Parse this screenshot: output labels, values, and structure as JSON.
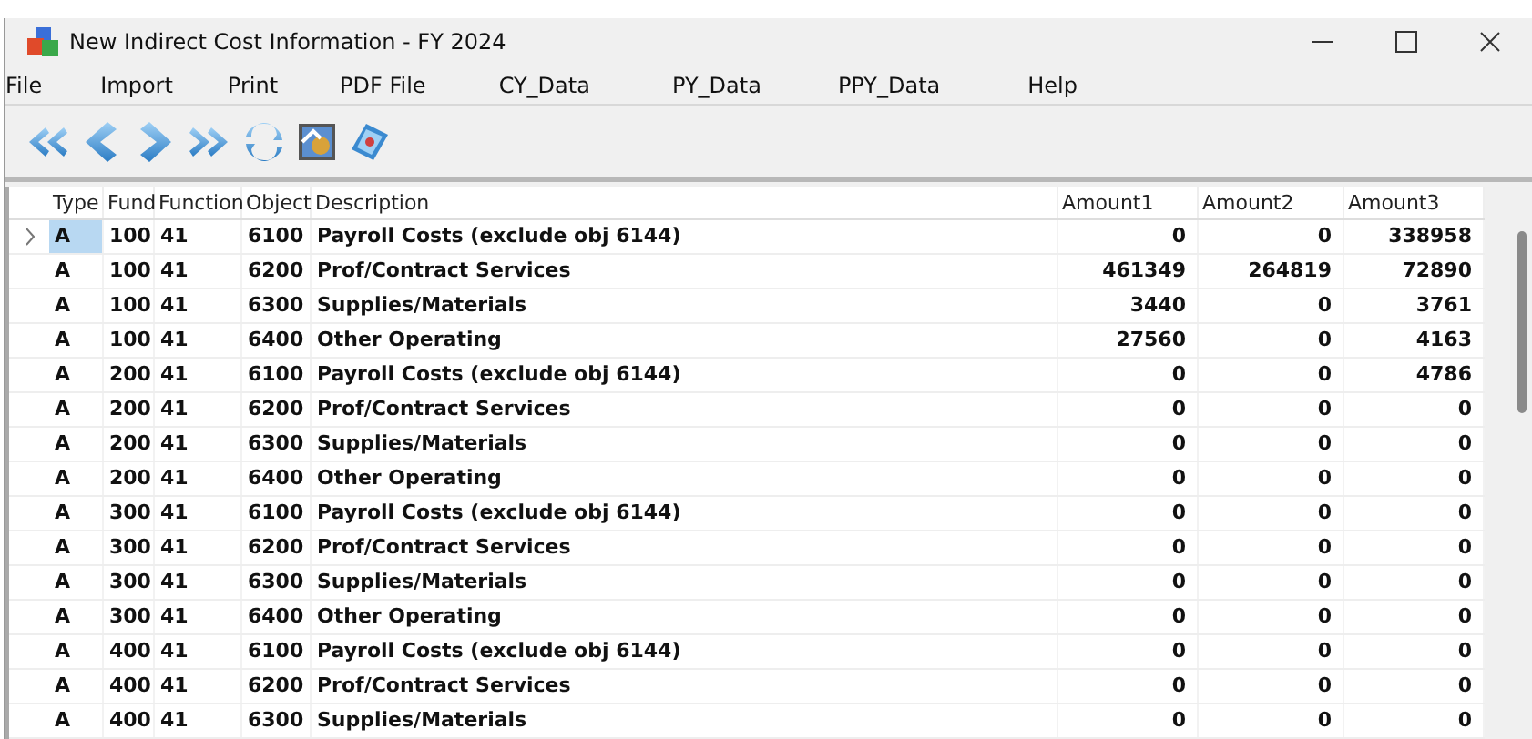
{
  "window": {
    "title": "New Indirect Cost Information - FY 2024"
  },
  "menu": [
    "File",
    "Import",
    "Print",
    "PDF File",
    "CY_Data",
    "PY_Data",
    "PPY_Data",
    "Help"
  ],
  "toolbar": [
    {
      "kind": "first"
    },
    {
      "kind": "prev"
    },
    {
      "kind": "next"
    },
    {
      "kind": "last"
    },
    {
      "kind": "refresh"
    },
    {
      "kind": "image"
    },
    {
      "kind": "help"
    }
  ],
  "table": {
    "columns": [
      "Type",
      "Fund",
      "Function",
      "Object",
      "Description",
      "Amount1",
      "Amount2",
      "Amount3"
    ],
    "rows": [
      {
        "selected": true,
        "cells": [
          "A",
          "100",
          "41",
          "6100",
          "Payroll Costs (exclude obj 6144)",
          "0",
          "0",
          "338958"
        ]
      },
      {
        "selected": false,
        "cells": [
          "A",
          "100",
          "41",
          "6200",
          "Prof/Contract Services",
          "461349",
          "264819",
          "72890"
        ]
      },
      {
        "selected": false,
        "cells": [
          "A",
          "100",
          "41",
          "6300",
          "Supplies/Materials",
          "3440",
          "0",
          "3761"
        ]
      },
      {
        "selected": false,
        "cells": [
          "A",
          "100",
          "41",
          "6400",
          "Other Operating",
          "27560",
          "0",
          "4163"
        ]
      },
      {
        "selected": false,
        "cells": [
          "A",
          "200",
          "41",
          "6100",
          "Payroll Costs (exclude obj 6144)",
          "0",
          "0",
          "4786"
        ]
      },
      {
        "selected": false,
        "cells": [
          "A",
          "200",
          "41",
          "6200",
          "Prof/Contract Services",
          "0",
          "0",
          "0"
        ]
      },
      {
        "selected": false,
        "cells": [
          "A",
          "200",
          "41",
          "6300",
          "Supplies/Materials",
          "0",
          "0",
          "0"
        ]
      },
      {
        "selected": false,
        "cells": [
          "A",
          "200",
          "41",
          "6400",
          "Other Operating",
          "0",
          "0",
          "0"
        ]
      },
      {
        "selected": false,
        "cells": [
          "A",
          "300",
          "41",
          "6100",
          "Payroll Costs (exclude obj 6144)",
          "0",
          "0",
          "0"
        ]
      },
      {
        "selected": false,
        "cells": [
          "A",
          "300",
          "41",
          "6200",
          "Prof/Contract Services",
          "0",
          "0",
          "0"
        ]
      },
      {
        "selected": false,
        "cells": [
          "A",
          "300",
          "41",
          "6300",
          "Supplies/Materials",
          "0",
          "0",
          "0"
        ]
      },
      {
        "selected": false,
        "cells": [
          "A",
          "300",
          "41",
          "6400",
          "Other Operating",
          "0",
          "0",
          "0"
        ]
      },
      {
        "selected": false,
        "cells": [
          "A",
          "400",
          "41",
          "6100",
          "Payroll Costs (exclude obj 6144)",
          "0",
          "0",
          "0"
        ]
      },
      {
        "selected": false,
        "cells": [
          "A",
          "400",
          "41",
          "6200",
          "Prof/Contract Services",
          "0",
          "0",
          "0"
        ]
      },
      {
        "selected": false,
        "cells": [
          "A",
          "400",
          "41",
          "6300",
          "Supplies/Materials",
          "0",
          "0",
          "0"
        ]
      }
    ]
  }
}
